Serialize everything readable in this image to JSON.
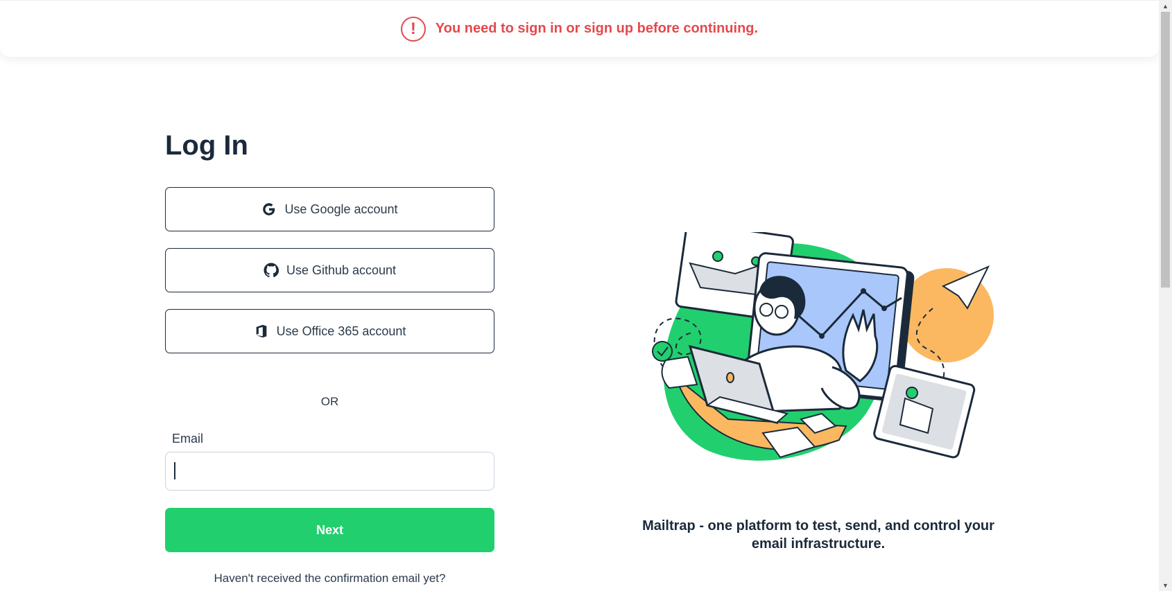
{
  "alert": {
    "message": "You need to sign in or sign up before continuing.",
    "icon": "exclamation-circle-icon",
    "color": "#e5484d"
  },
  "login": {
    "title": "Log In",
    "google_label": "Use Google account",
    "github_label": "Use Github account",
    "office_label": "Use Office 365 account",
    "or_label": "OR",
    "email_label": "Email",
    "email_value": "",
    "next_label": "Next",
    "confirmation_link": "Haven't received the confirmation email yet?"
  },
  "promo": {
    "tagline_line1": "Mailtrap - one platform to test, send, and control your",
    "tagline_line2": "email infrastructure."
  },
  "colors": {
    "accent_green": "#22cf6e",
    "text_dark": "#1b2a3a",
    "illustration_orange": "#fbb860",
    "illustration_blue": "#a9c7fb"
  }
}
